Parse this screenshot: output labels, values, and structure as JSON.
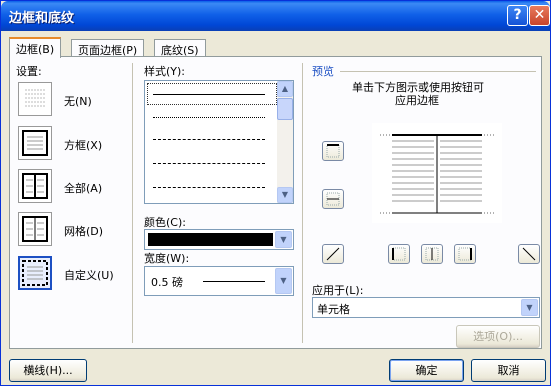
{
  "window": {
    "title": "边框和底纹"
  },
  "titlebar": {
    "help_label": "?",
    "close_label": "✕"
  },
  "tabs": [
    {
      "label": "边框(B)"
    },
    {
      "label": "页面边框(P)"
    },
    {
      "label": "底纹(S)"
    }
  ],
  "settings": {
    "heading": "设置:",
    "items": [
      {
        "label": "无(N)",
        "icon": "none-border-icon"
      },
      {
        "label": "方框(X)",
        "icon": "box-border-icon"
      },
      {
        "label": "全部(A)",
        "icon": "all-border-icon"
      },
      {
        "label": "网格(D)",
        "icon": "grid-border-icon"
      },
      {
        "label": "自定义(U)",
        "icon": "custom-border-icon"
      }
    ],
    "selected": "自定义(U)"
  },
  "style": {
    "heading": "样式(Y):"
  },
  "color": {
    "label": "颜色(C):",
    "value": "#000000"
  },
  "width": {
    "label": "宽度(W):",
    "value": "0.5 磅"
  },
  "preview": {
    "heading": "预览",
    "hint_line1": "单击下方图示或使用按钮可",
    "hint_line2": "应用边框"
  },
  "apply_to": {
    "label": "应用于(L):",
    "value": "单元格"
  },
  "buttons": {
    "options": "选项(O)...",
    "horizontal_line": "横线(H)...",
    "ok": "确定",
    "cancel": "取消"
  }
}
